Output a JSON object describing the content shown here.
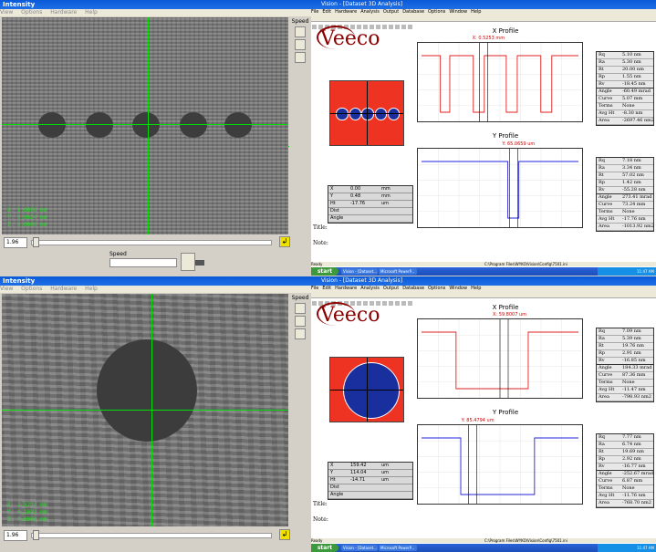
{
  "intensity_top": {
    "title": "Intensity",
    "menu": [
      "View",
      "Options",
      "Hardware",
      "Help"
    ],
    "speed_label": "Speed",
    "readout": [
      "X: 1.6898 mm",
      "Y: 0.9624 mm",
      "Z: 0.0000 mm"
    ],
    "value": "1.96",
    "speed_bottom_label": "Speed"
  },
  "intensity_bottom": {
    "title": "Intensity",
    "menu": [
      "View",
      "Options",
      "Hardware",
      "Help"
    ],
    "speed_label": "Speed",
    "readout": [
      "X: 2.5214 mm",
      "Y: 0.1033 mm",
      "Z: 0.0000 mm"
    ],
    "value": "1.96"
  },
  "vision_top": {
    "title": "Vision - [Dataset 3D Analysis]",
    "menu": [
      "File",
      "Edit",
      "Hardware",
      "Analysis",
      "Output",
      "Database",
      "Options",
      "Window",
      "Help"
    ],
    "logo": "Veeco",
    "x_profile": {
      "title": "X Profile",
      "marker": "X: 0.5253 mm"
    },
    "y_profile": {
      "title": "Y Profile",
      "marker": "Y: 65.0659 um"
    },
    "info": [
      [
        "X",
        "0.00",
        "mm"
      ],
      [
        "Y",
        "0.48",
        "mm"
      ],
      [
        "Ht",
        "-17.76",
        "um"
      ],
      [
        "Dist",
        "",
        ""
      ],
      [
        "Angle",
        "",
        ""
      ]
    ],
    "title_label": "Title:",
    "note_label": "Note:",
    "x_stats": [
      [
        "Rq",
        "5.10 nm"
      ],
      [
        "Ra",
        "5.30 nm"
      ],
      [
        "Rt",
        "20.00 nm"
      ],
      [
        "Rp",
        "1.55 nm"
      ],
      [
        "Rv",
        "-18.45 nm"
      ]
    ],
    "x_stats2": [
      [
        "Angle",
        "-60.49 mrad"
      ],
      [
        "Curve",
        "5.07 mm"
      ],
      [
        "Terms",
        "None"
      ],
      [
        "Avg Ht",
        "-8.30 nm"
      ],
      [
        "Area",
        "-2697.46 nm2"
      ]
    ],
    "y_stats": [
      [
        "Rq",
        "7.18 nm"
      ],
      [
        "Ra",
        "3.34 nm"
      ],
      [
        "Rt",
        "57.02 nm"
      ],
      [
        "Rp",
        "1.42 nm"
      ],
      [
        "Rv",
        "-55.28 nm"
      ]
    ],
    "y_stats2": [
      [
        "Angle",
        "273.41 mrad"
      ],
      [
        "Curve",
        "73.24 mm"
      ],
      [
        "Terms",
        "None"
      ],
      [
        "Avg Ht",
        "-17.76 nm"
      ],
      [
        "Area",
        "-1013.92 nm2"
      ]
    ],
    "status_left": "Ready",
    "status_right": "C:\\Program Files\\WYKO\\Vision\\Config\\7501.ini"
  },
  "vision_bottom": {
    "title": "Vision - [Dataset 3D Analysis]",
    "menu": [
      "File",
      "Edit",
      "Hardware",
      "Analysis",
      "Output",
      "Database",
      "Options",
      "Window",
      "Help"
    ],
    "logo": "Veeco",
    "x_profile": {
      "title": "X Profile",
      "marker": "X: 59.8007 um"
    },
    "y_profile": {
      "title": "Y Profile",
      "marker": "Y: 85.4794 um"
    },
    "info": [
      [
        "X",
        "159.42",
        "um"
      ],
      [
        "Y",
        "114.04",
        "um"
      ],
      [
        "Ht",
        "-14.71",
        "um"
      ],
      [
        "Dist",
        "",
        ""
      ],
      [
        "Angle",
        "",
        ""
      ]
    ],
    "title_label": "Title:",
    "note_label": "Note:",
    "x_stats": [
      [
        "Rq",
        "7.09 nm"
      ],
      [
        "Ra",
        "5.39 nm"
      ],
      [
        "Rt",
        "19.76 nm"
      ],
      [
        "Rp",
        "2.91 nm"
      ],
      [
        "Rv",
        "-16.85 nm"
      ]
    ],
    "x_stats2": [
      [
        "Angle",
        "184.33 mrad"
      ],
      [
        "Curve",
        "87.36 mm"
      ],
      [
        "Terms",
        "None"
      ],
      [
        "Avg Ht",
        "-11.47 nm"
      ],
      [
        "Area",
        "-798.93 nm2"
      ]
    ],
    "y_stats": [
      [
        "Rq",
        "7.77 nm"
      ],
      [
        "Ra",
        "6.74 nm"
      ],
      [
        "Rt",
        "19.69 nm"
      ],
      [
        "Rp",
        "2.92 nm"
      ],
      [
        "Rv",
        "-16.77 nm"
      ]
    ],
    "y_stats2": [
      [
        "Angle",
        "-252.67 mrad"
      ],
      [
        "Curve",
        "6.87 mm"
      ],
      [
        "Terms",
        "None"
      ],
      [
        "Avg Ht",
        "-11.76 nm"
      ],
      [
        "Area",
        "-768.70 nm2"
      ]
    ],
    "status_left": "Ready",
    "status_right": "C:\\Program Files\\WYKO\\Vision\\Config\\7501.ini"
  },
  "taskbar": {
    "start": "start",
    "tasks": [
      "Vision - [Dataset...",
      "Microsoft PowerP..."
    ],
    "tray": "11:47 AM"
  },
  "colors": {
    "profile_x": "#dd2222",
    "profile_y": "#2222dd",
    "map_bg": "#ee3322",
    "crosshair": "#00e000"
  }
}
